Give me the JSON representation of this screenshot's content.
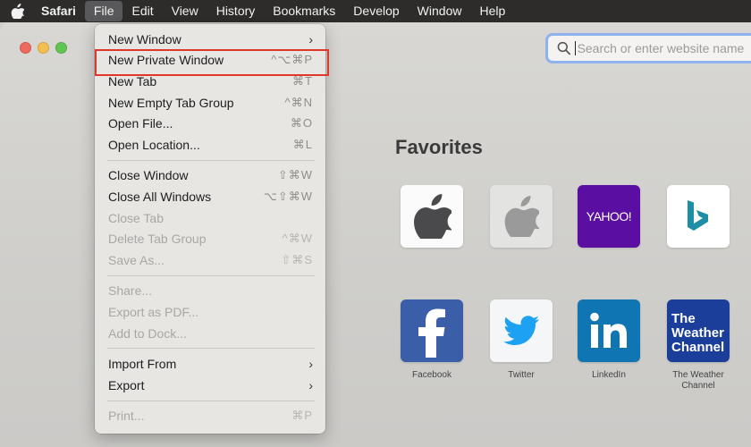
{
  "menubar": {
    "app_name": "Safari",
    "items": [
      "File",
      "Edit",
      "View",
      "History",
      "Bookmarks",
      "Develop",
      "Window",
      "Help"
    ]
  },
  "search": {
    "placeholder": "Search or enter website name"
  },
  "favorites": {
    "title": "Favorites",
    "tiles": [
      {
        "label": "",
        "icon": "apple-logo-icon"
      },
      {
        "label": "",
        "icon": "apple-logo-icon"
      },
      {
        "label": "",
        "icon": "yahoo-logo-icon",
        "text": "YAHOO!"
      },
      {
        "label": "",
        "icon": "bing-logo-icon"
      },
      {
        "label": "Facebook",
        "icon": "facebook-logo-icon"
      },
      {
        "label": "Twitter",
        "icon": "twitter-logo-icon"
      },
      {
        "label": "LinkedIn",
        "icon": "linkedin-logo-icon"
      },
      {
        "label": "The Weather Channel",
        "icon": "weather-channel-logo-icon",
        "text": "The Weather Channel"
      }
    ]
  },
  "file_menu": {
    "groups": [
      [
        {
          "label": "New Window",
          "shortcut": "",
          "submenu": true,
          "enabled": true
        },
        {
          "label": "New Private Window",
          "shortcut": "^⌥⌘P",
          "submenu": false,
          "enabled": true,
          "highlighted": true
        },
        {
          "label": "New Tab",
          "shortcut": "⌘T",
          "submenu": false,
          "enabled": true
        },
        {
          "label": "New Empty Tab Group",
          "shortcut": "^⌘N",
          "submenu": false,
          "enabled": true
        },
        {
          "label": "Open File...",
          "shortcut": "⌘O",
          "submenu": false,
          "enabled": true
        },
        {
          "label": "Open Location...",
          "shortcut": "⌘L",
          "submenu": false,
          "enabled": true
        }
      ],
      [
        {
          "label": "Close Window",
          "shortcut": "⇧⌘W",
          "submenu": false,
          "enabled": true
        },
        {
          "label": "Close All Windows",
          "shortcut": "⌥⇧⌘W",
          "submenu": false,
          "enabled": true
        },
        {
          "label": "Close Tab",
          "shortcut": "",
          "submenu": false,
          "enabled": false
        },
        {
          "label": "Delete Tab Group",
          "shortcut": "^⌘W",
          "submenu": false,
          "enabled": false
        },
        {
          "label": "Save As...",
          "shortcut": "⇧⌘S",
          "submenu": false,
          "enabled": false
        }
      ],
      [
        {
          "label": "Share...",
          "shortcut": "",
          "submenu": false,
          "enabled": false
        },
        {
          "label": "Export as PDF...",
          "shortcut": "",
          "submenu": false,
          "enabled": false
        },
        {
          "label": "Add to Dock...",
          "shortcut": "",
          "submenu": false,
          "enabled": false
        }
      ],
      [
        {
          "label": "Import From",
          "shortcut": "",
          "submenu": true,
          "enabled": true
        },
        {
          "label": "Export",
          "shortcut": "",
          "submenu": true,
          "enabled": true
        }
      ],
      [
        {
          "label": "Print...",
          "shortcut": "⌘P",
          "submenu": false,
          "enabled": false
        }
      ]
    ]
  },
  "colors": {
    "menubar_bg": "#2d2c2a",
    "highlight_border": "#e0372a",
    "search_focus": "#8fb1ee"
  }
}
